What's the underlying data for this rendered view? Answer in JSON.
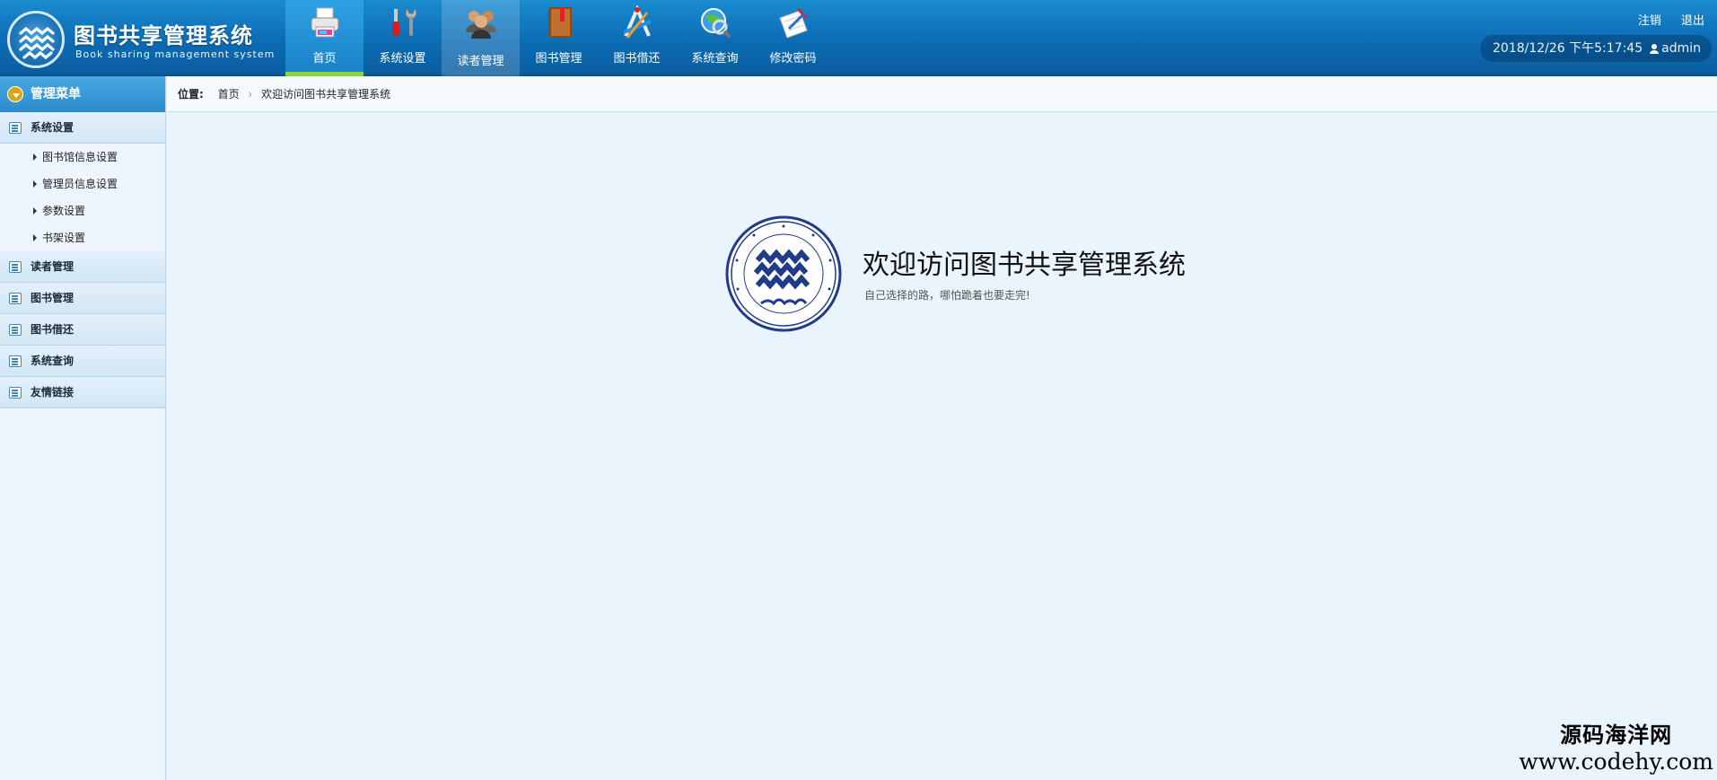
{
  "app": {
    "title": "图书共享管理系统",
    "subtitle": "Book sharing management system"
  },
  "nav": [
    {
      "label": "首页",
      "icon": "printer-icon"
    },
    {
      "label": "系统设置",
      "icon": "tools-icon"
    },
    {
      "label": "读者管理",
      "icon": "users-icon"
    },
    {
      "label": "图书管理",
      "icon": "book-icon"
    },
    {
      "label": "图书借还",
      "icon": "drafting-icon"
    },
    {
      "label": "系统查询",
      "icon": "globe-search-icon"
    },
    {
      "label": "修改密码",
      "icon": "edit-doc-icon"
    }
  ],
  "top_links": {
    "logout_label": "注销",
    "exit_label": "退出"
  },
  "status": {
    "datetime": "2018/12/26 下午5:17:45",
    "user": "admin"
  },
  "sidebar": {
    "header": "管理菜单",
    "groups": [
      {
        "label": "系统设置",
        "items": [
          "图书馆信息设置",
          "管理员信息设置",
          "参数设置",
          "书架设置"
        ]
      },
      {
        "label": "读者管理",
        "items": []
      },
      {
        "label": "图书管理",
        "items": []
      },
      {
        "label": "图书借还",
        "items": []
      },
      {
        "label": "系统查询",
        "items": []
      },
      {
        "label": "友情链接",
        "items": []
      }
    ]
  },
  "breadcrumb": {
    "prefix": "位置:",
    "home": "首页",
    "current": "欢迎访问图书共享管理系统"
  },
  "welcome": {
    "title": "欢迎访问图书共享管理系统",
    "subtitle": "自己选择的路，哪怕跪着也要走完!"
  },
  "watermark": {
    "line1": "源码海洋网",
    "line2": "www.codehy.com"
  },
  "colors": {
    "header": "#0d6cb4",
    "accent_green": "#8bd33b",
    "sidebar_bg": "#edf6fd",
    "seal_blue": "#1f3b8a"
  }
}
